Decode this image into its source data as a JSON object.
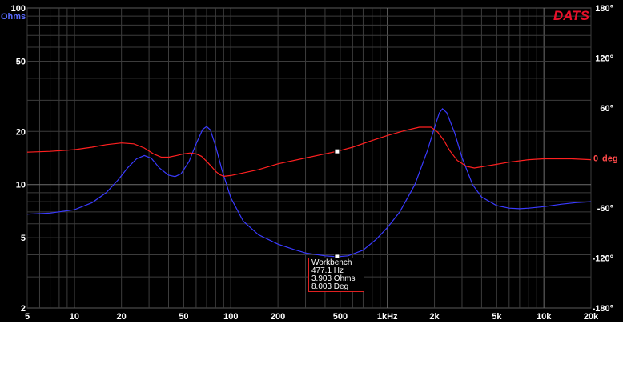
{
  "brand": "DATS",
  "chart_data": {
    "type": "line",
    "title": "",
    "xlabel": "",
    "x_scale": "log",
    "xlim": [
      5,
      20000
    ],
    "x_tick_labels": [
      {
        "v": 5,
        "t": "5"
      },
      {
        "v": 10,
        "t": "10"
      },
      {
        "v": 20,
        "t": "20"
      },
      {
        "v": 50,
        "t": "50"
      },
      {
        "v": 100,
        "t": "100"
      },
      {
        "v": 200,
        "t": "200"
      },
      {
        "v": 500,
        "t": "500"
      },
      {
        "v": 1000,
        "t": "1kHz"
      },
      {
        "v": 2000,
        "t": "2k"
      },
      {
        "v": 5000,
        "t": "5k"
      },
      {
        "v": 10000,
        "t": "10k"
      },
      {
        "v": 20000,
        "t": "20k"
      }
    ],
    "y_left": {
      "label": "Ohms",
      "scale": "log",
      "lim": [
        2,
        100
      ],
      "tick_labels": [
        {
          "v": 100,
          "t": "100"
        },
        {
          "v": 50,
          "t": "50"
        },
        {
          "v": 20,
          "t": "20"
        },
        {
          "v": 10,
          "t": "10"
        },
        {
          "v": 5,
          "t": "5"
        },
        {
          "v": 2,
          "t": "2"
        }
      ]
    },
    "y_right": {
      "label": "deg",
      "lim": [
        -180,
        180
      ],
      "tick_labels": [
        {
          "v": 180,
          "t": "180°"
        },
        {
          "v": 120,
          "t": "120°"
        },
        {
          "v": 60,
          "t": "60°"
        },
        {
          "v": 0,
          "t": "0"
        },
        {
          "v": -60,
          "t": "-60°"
        },
        {
          "v": -120,
          "t": "-120°"
        },
        {
          "v": -180,
          "t": "-180°"
        }
      ]
    },
    "grid": true,
    "series": [
      {
        "axis": "left",
        "color": "#3a3aff",
        "points": [
          [
            5,
            6.8
          ],
          [
            7,
            6.9
          ],
          [
            10,
            7.2
          ],
          [
            13,
            7.9
          ],
          [
            16,
            9.0
          ],
          [
            19,
            10.6
          ],
          [
            22,
            12.5
          ],
          [
            25,
            14.0
          ],
          [
            28,
            14.6
          ],
          [
            31,
            14.1
          ],
          [
            35,
            12.4
          ],
          [
            40,
            11.3
          ],
          [
            44,
            11.1
          ],
          [
            48,
            11.5
          ],
          [
            54,
            13.5
          ],
          [
            60,
            17.0
          ],
          [
            66,
            20.5
          ],
          [
            70,
            21.3
          ],
          [
            74,
            20.4
          ],
          [
            80,
            16.5
          ],
          [
            88,
            12.0
          ],
          [
            100,
            8.4
          ],
          [
            120,
            6.2
          ],
          [
            150,
            5.2
          ],
          [
            200,
            4.6
          ],
          [
            250,
            4.3
          ],
          [
            300,
            4.1
          ],
          [
            400,
            3.95
          ],
          [
            477,
            3.903
          ],
          [
            560,
            3.95
          ],
          [
            700,
            4.25
          ],
          [
            850,
            4.9
          ],
          [
            1000,
            5.7
          ],
          [
            1200,
            7.0
          ],
          [
            1500,
            10.0
          ],
          [
            1800,
            15.5
          ],
          [
            2000,
            21.0
          ],
          [
            2150,
            25.5
          ],
          [
            2250,
            26.9
          ],
          [
            2400,
            25.5
          ],
          [
            2700,
            19.5
          ],
          [
            3000,
            14.2
          ],
          [
            3500,
            10.0
          ],
          [
            4000,
            8.5
          ],
          [
            5000,
            7.6
          ],
          [
            6000,
            7.35
          ],
          [
            7000,
            7.3
          ],
          [
            8000,
            7.35
          ],
          [
            10000,
            7.5
          ],
          [
            13000,
            7.75
          ],
          [
            16000,
            7.9
          ],
          [
            20000,
            8.0
          ]
        ]
      },
      {
        "axis": "right",
        "color": "#ff2020",
        "points": [
          [
            5,
            7
          ],
          [
            7,
            8
          ],
          [
            10,
            10
          ],
          [
            13,
            13
          ],
          [
            16,
            16
          ],
          [
            20,
            18
          ],
          [
            24,
            17
          ],
          [
            28,
            12
          ],
          [
            32,
            5
          ],
          [
            36,
            1
          ],
          [
            40,
            1
          ],
          [
            45,
            3
          ],
          [
            50,
            5
          ],
          [
            55,
            6
          ],
          [
            60,
            5
          ],
          [
            65,
            2
          ],
          [
            70,
            -4
          ],
          [
            75,
            -10
          ],
          [
            80,
            -16
          ],
          [
            85,
            -20
          ],
          [
            90,
            -22
          ],
          [
            100,
            -21
          ],
          [
            150,
            -14
          ],
          [
            200,
            -7
          ],
          [
            300,
            0
          ],
          [
            400,
            5
          ],
          [
            477,
            8.003
          ],
          [
            600,
            13
          ],
          [
            800,
            21
          ],
          [
            1000,
            27
          ],
          [
            1300,
            33
          ],
          [
            1600,
            37
          ],
          [
            1900,
            37
          ],
          [
            2100,
            31
          ],
          [
            2300,
            21
          ],
          [
            2500,
            9
          ],
          [
            2800,
            -3
          ],
          [
            3200,
            -10
          ],
          [
            3600,
            -12
          ],
          [
            4500,
            -9
          ],
          [
            6000,
            -5
          ],
          [
            8000,
            -2
          ],
          [
            10000,
            -1
          ],
          [
            15000,
            -1
          ],
          [
            20000,
            -2
          ]
        ]
      }
    ],
    "cursor": {
      "x": 477.1,
      "impedance": 3.903,
      "phase": 8.003
    },
    "annotation": {
      "line1": "Workbench",
      "line2": "477.1 Hz",
      "line3": "3.903 Ohms",
      "line4": "8.003 Deg"
    }
  }
}
